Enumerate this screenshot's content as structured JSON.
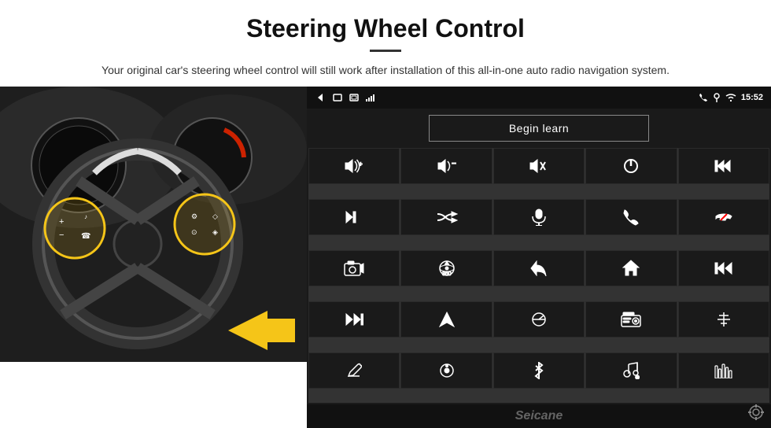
{
  "header": {
    "title": "Steering Wheel Control",
    "subtitle": "Your original car's steering wheel control will still work after installation of this all-in-one auto radio navigation system."
  },
  "status_bar": {
    "time": "15:52",
    "back_icon": "◁",
    "home_icon": "□",
    "recent_icon": "▭"
  },
  "begin_learn": {
    "label": "Begin learn"
  },
  "control_grid": {
    "cells": [
      {
        "icon": "vol_up",
        "unicode": "🔊+"
      },
      {
        "icon": "vol_down",
        "unicode": "🔊-"
      },
      {
        "icon": "mute",
        "unicode": "🔇"
      },
      {
        "icon": "power",
        "unicode": "⏻"
      },
      {
        "icon": "prev_track",
        "unicode": "⏮"
      },
      {
        "icon": "next",
        "unicode": "⏭"
      },
      {
        "icon": "shuffle",
        "unicode": "⇌⏭"
      },
      {
        "icon": "mic",
        "unicode": "🎤"
      },
      {
        "icon": "phone",
        "unicode": "📞"
      },
      {
        "icon": "end_call",
        "unicode": "📵"
      },
      {
        "icon": "camera",
        "unicode": "📷"
      },
      {
        "icon": "360",
        "unicode": "360"
      },
      {
        "icon": "back",
        "unicode": "↩"
      },
      {
        "icon": "home",
        "unicode": "⌂"
      },
      {
        "icon": "skip_back",
        "unicode": "⏮⏮"
      },
      {
        "icon": "ff",
        "unicode": "⏭⏭"
      },
      {
        "icon": "nav",
        "unicode": "➤"
      },
      {
        "icon": "eq",
        "unicode": "⇌"
      },
      {
        "icon": "radio",
        "unicode": "📻"
      },
      {
        "icon": "settings2",
        "unicode": "⚙"
      },
      {
        "icon": "pen",
        "unicode": "✏"
      },
      {
        "icon": "knob",
        "unicode": "⊙"
      },
      {
        "icon": "bt",
        "unicode": "⚡"
      },
      {
        "icon": "music",
        "unicode": "🎵"
      },
      {
        "icon": "bars",
        "unicode": "|||"
      }
    ]
  },
  "watermark": "Seicane",
  "settings_icon": "⚙"
}
